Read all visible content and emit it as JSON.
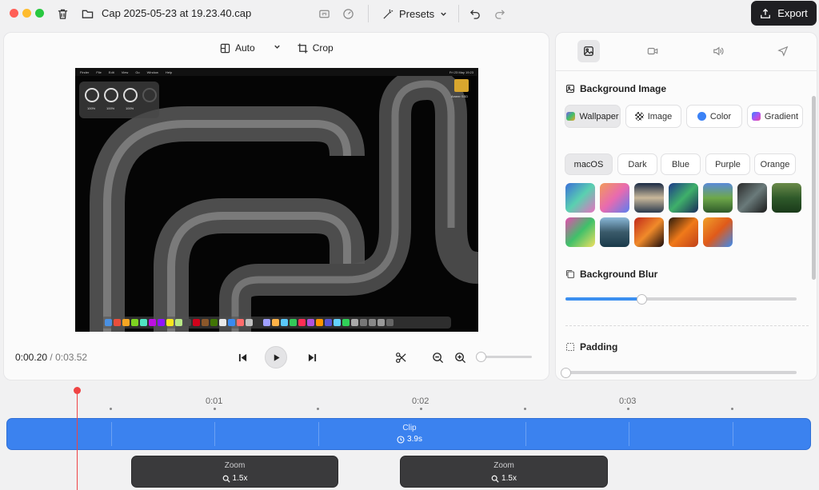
{
  "titlebar": {
    "filename": "Cap 2025-05-23 at 19.23.40.cap",
    "presets_label": "Presets",
    "export_label": "Export"
  },
  "editor": {
    "aspect_label": "Auto",
    "crop_label": "Crop",
    "current_time": "0:00.20",
    "separator": " / ",
    "total_time": "0:03.52",
    "preview": {
      "menubar_items": [
        "Finder",
        "File",
        "Edit",
        "View",
        "Go",
        "Window",
        "Help"
      ],
      "menubar_clock": "Fri 23 May 19:23",
      "widget_labels": [
        "100%",
        "100%",
        "100%"
      ],
      "desktop_icon_label": "Ameer SSD"
    }
  },
  "settings": {
    "background_image_title": "Background Image",
    "source_tabs": [
      {
        "label": "Wallpaper",
        "color": "#7b5cf0"
      },
      {
        "label": "Image",
        "color": "#333333"
      },
      {
        "label": "Color",
        "color": "#3b82f6"
      },
      {
        "label": "Gradient",
        "color": "#a855f7"
      }
    ],
    "theme_tabs": [
      "macOS",
      "Dark",
      "Blue",
      "Purple",
      "Orange"
    ],
    "wallpapers": [
      "linear-gradient(135deg,#3a6fd8,#5ad0b0,#e870c0)",
      "linear-gradient(135deg,#f29a5a,#e86ab0,#5a7ef0)",
      "linear-gradient(180deg,#1a2a44,#c9b89a,#2b3a4e)",
      "linear-gradient(135deg,#1c3a8a,#3fb06a,#1a2a5a)",
      "linear-gradient(180deg,#5a8ad8,#6ea84a,#2f5a2a)",
      "linear-gradient(135deg,#2a2a2a,#6a7a7a,#1a1a1a)",
      "linear-gradient(180deg,#6a8a4a,#2f5a2a,#1a3a1a)",
      "linear-gradient(135deg,#e84ab0,#3fc06a,#f0e060)",
      "linear-gradient(180deg,#8ab8d8,#3a5a6a,#1a3a4a)",
      "linear-gradient(135deg,#c0281a,#f08a2a,#1a0a0a)",
      "linear-gradient(135deg,#2a1a0a,#f07a1a,#c0401a)",
      "linear-gradient(135deg,#f0a02a,#e05a1a,#3a8af0)"
    ],
    "blur_title": "Background Blur",
    "blur_value": 0.33,
    "padding_title": "Padding",
    "padding_value": 0.0
  },
  "timeline": {
    "ticks": [
      "0:01",
      "0:02",
      "0:03"
    ],
    "clip_label": "Clip",
    "clip_duration": "3.9s",
    "zoom_segments": [
      {
        "title": "Zoom",
        "value": "1.5x"
      },
      {
        "title": "Zoom",
        "value": "1.5x"
      }
    ]
  },
  "colors": {
    "accent": "#3b82ef",
    "playhead": "#ef4444",
    "export_bg": "#1f1f22"
  }
}
